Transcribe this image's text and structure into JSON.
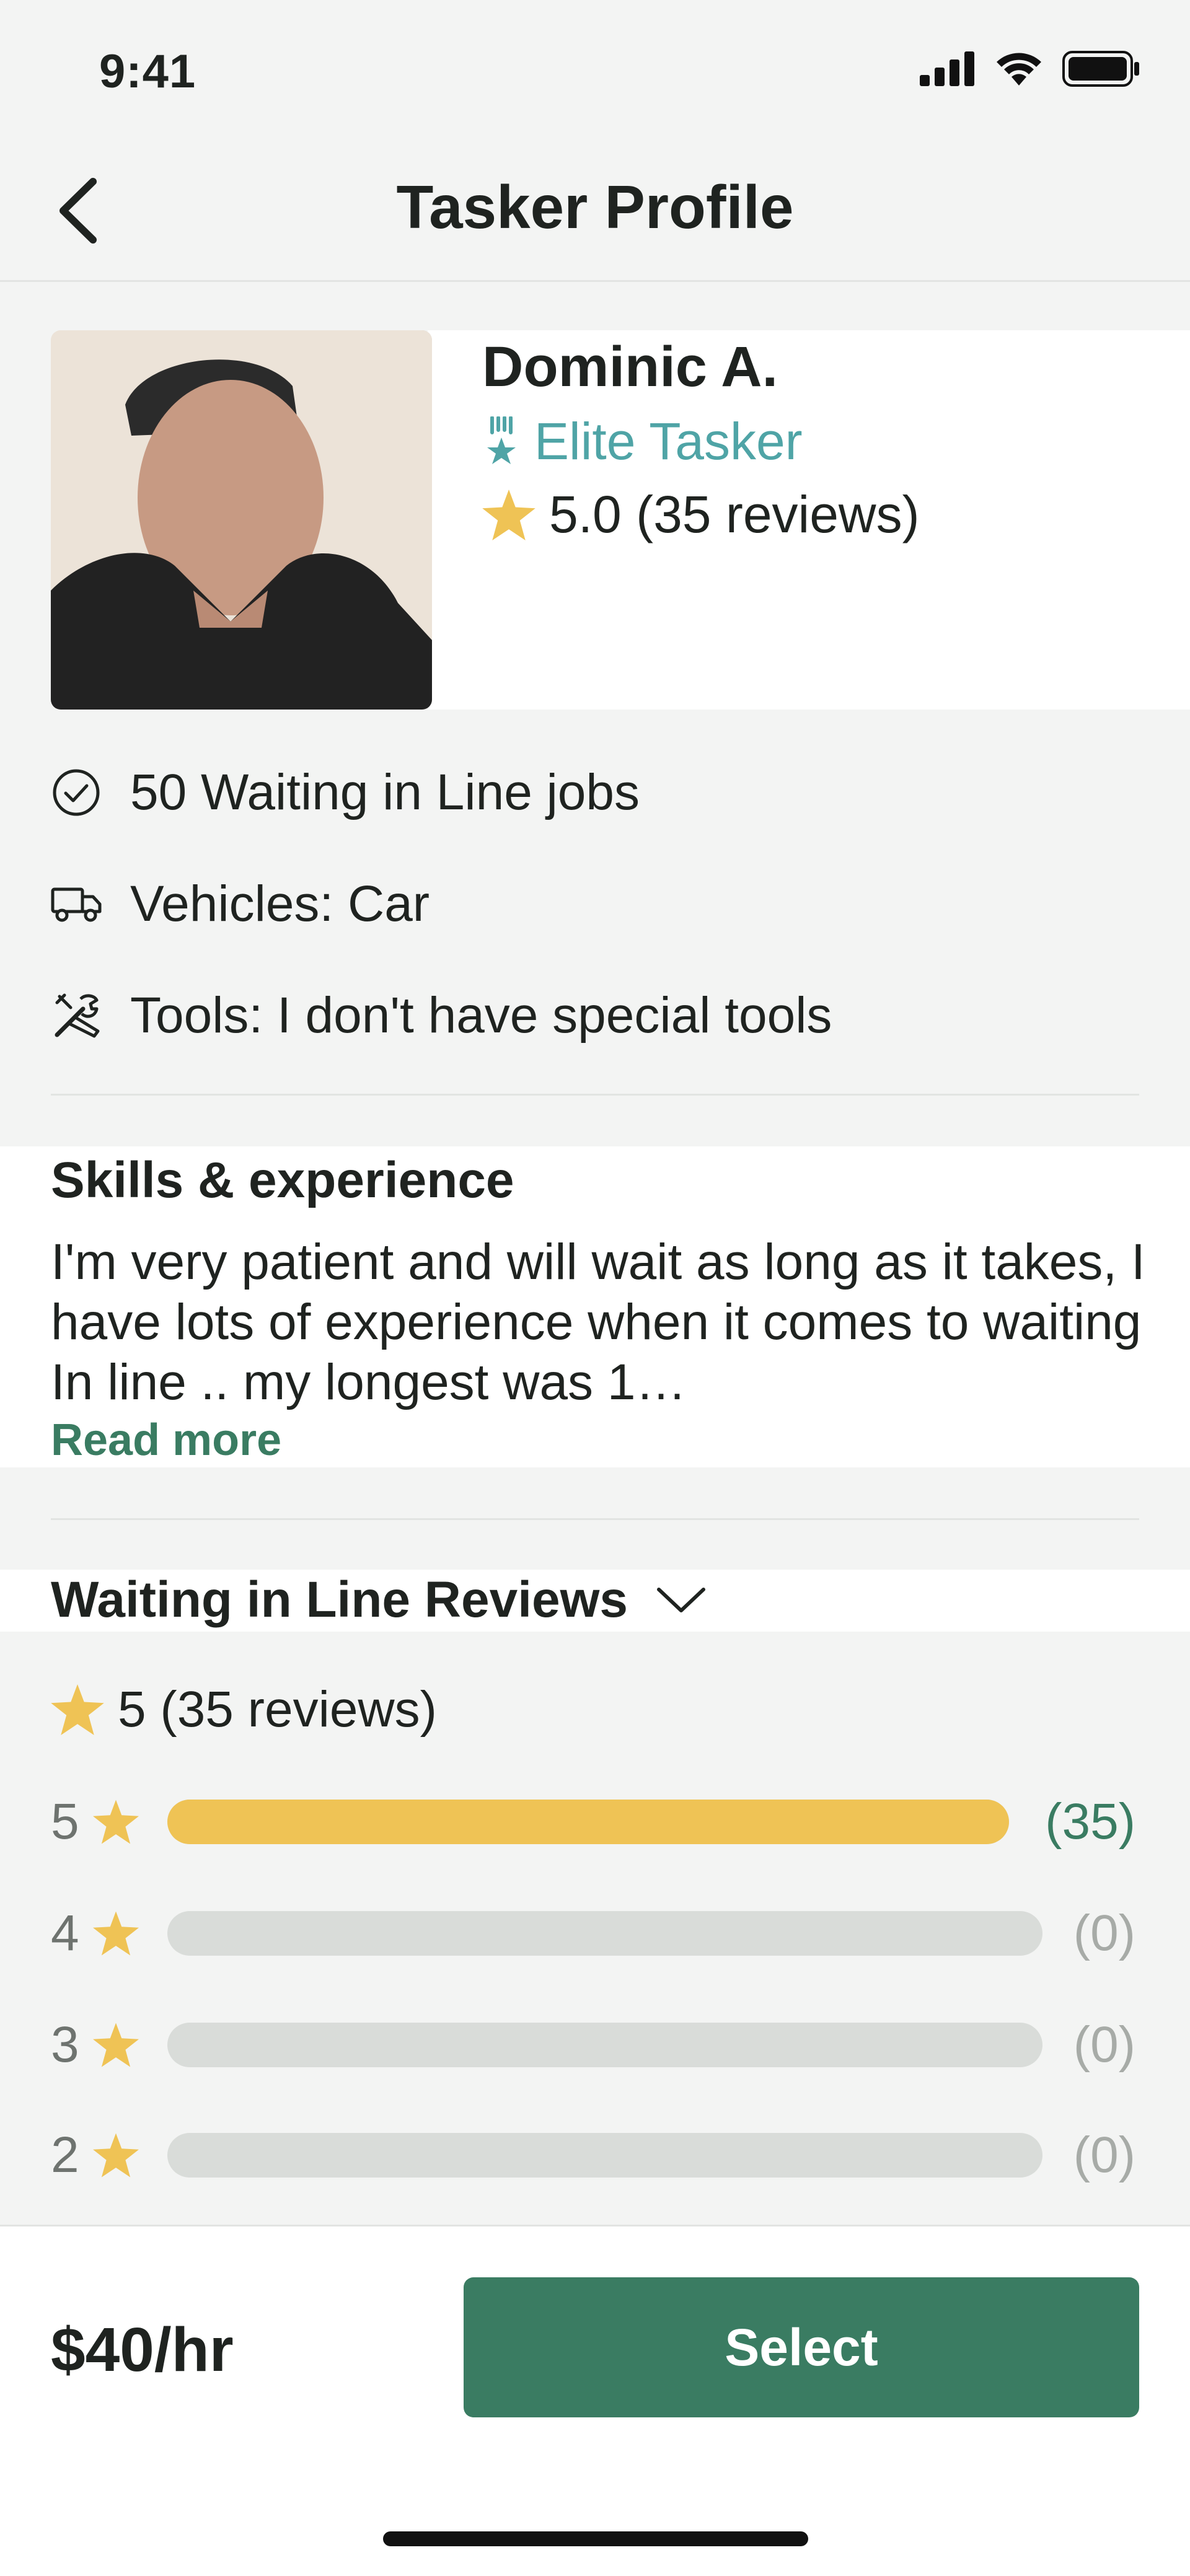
{
  "status_bar": {
    "time": "9:41"
  },
  "header": {
    "title": "Tasker Profile",
    "back_icon": "chevron-left-icon"
  },
  "profile": {
    "name": "Dominic A.",
    "badge": "Elite Tasker",
    "rating_text": "5.0 (35 reviews)"
  },
  "info": {
    "jobs": "50 Waiting in Line jobs",
    "vehicles": "Vehicles: Car",
    "tools": "Tools: I don't have special tools"
  },
  "skills": {
    "heading": "Skills & experience",
    "text": "I'm very patient and will wait as long as it takes, I have lots of experience when it comes to waiting In line .. my longest was 1…",
    "read_more": "Read more"
  },
  "reviews": {
    "heading": "Waiting in Line Reviews",
    "summary": "5 (35 reviews)",
    "breakdown": [
      {
        "stars": "5",
        "count": "(35)",
        "fraction": 1.0
      },
      {
        "stars": "4",
        "count": "(0)",
        "fraction": 0.0
      },
      {
        "stars": "3",
        "count": "(0)",
        "fraction": 0.0
      },
      {
        "stars": "2",
        "count": "(0)",
        "fraction": 0.0
      }
    ]
  },
  "footer": {
    "price": "$40/hr",
    "select_label": "Select"
  },
  "colors": {
    "accent": "#3a7c62",
    "star": "#efc355",
    "elite": "#4fa4a6",
    "bar_track": "#d9dcd9"
  }
}
